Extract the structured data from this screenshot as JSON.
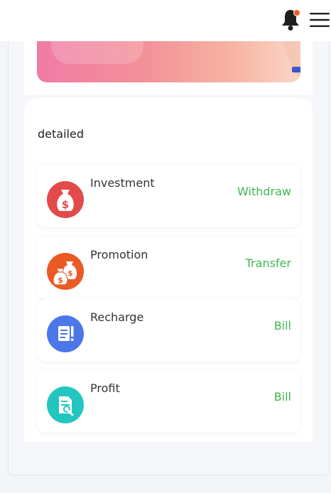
{
  "header": {
    "bell_icon": "bell-icon",
    "menu_icon": "hamburger-menu-icon"
  },
  "colors": {
    "action_green": "#3fb650",
    "investment_red": "#e34a4a",
    "promotion_orange": "#e95a25",
    "recharge_blue": "#4c77e8",
    "profit_teal": "#22c6bf"
  },
  "section": {
    "title": "detailed"
  },
  "items": [
    {
      "label": "Investment",
      "action": "Withdraw",
      "icon": "money-bag-icon"
    },
    {
      "label": "Promotion",
      "action": "Transfer",
      "icon": "money-bags-icon"
    },
    {
      "label": "Recharge",
      "action": "Bill",
      "icon": "receipt-icon"
    },
    {
      "label": "Profit",
      "action": "Bill",
      "icon": "document-search-icon"
    }
  ]
}
